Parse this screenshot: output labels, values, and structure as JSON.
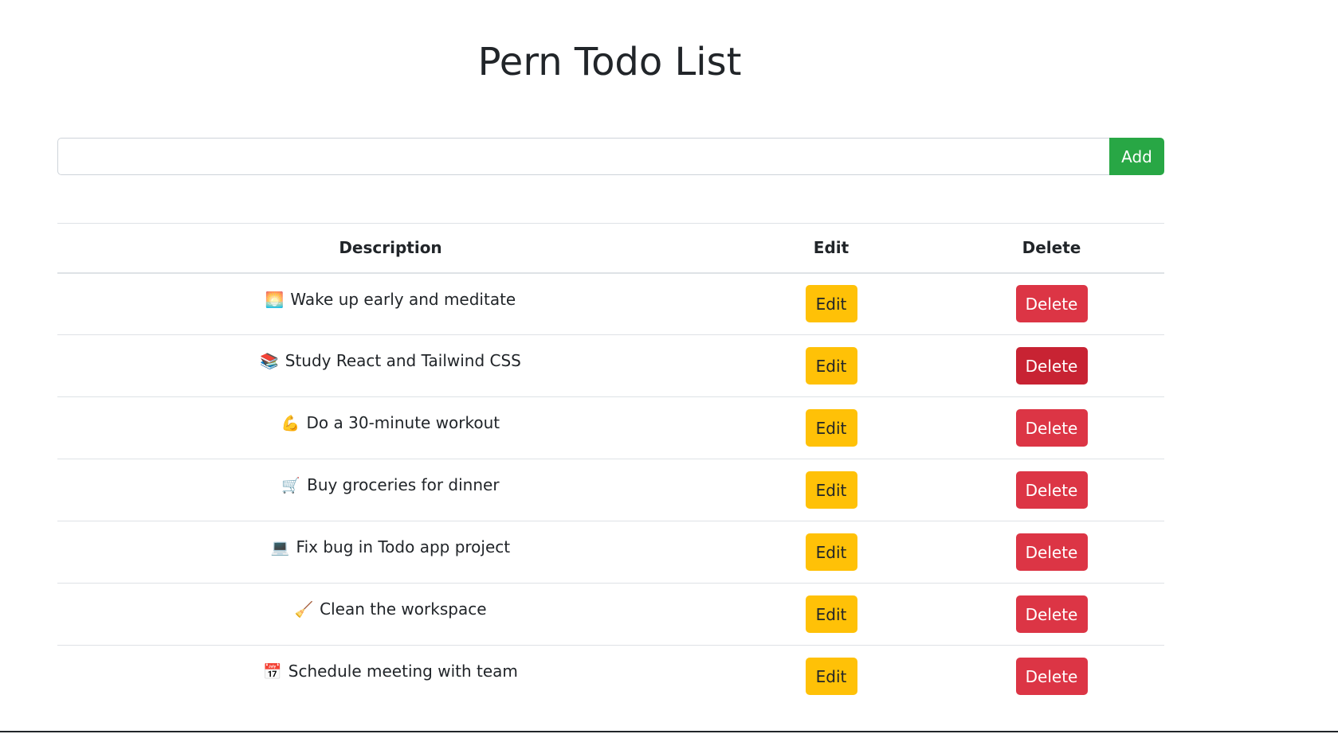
{
  "title": "Pern Todo List",
  "input": {
    "value": "",
    "placeholder": ""
  },
  "add_button_label": "Add",
  "table": {
    "headers": [
      "Description",
      "Edit",
      "Delete"
    ],
    "rows": [
      {
        "emoji": "🌅",
        "description": "Wake up early and meditate",
        "edit_label": "Edit",
        "delete_label": "Delete"
      },
      {
        "emoji": "📚",
        "description": "Study React and Tailwind CSS",
        "edit_label": "Edit",
        "delete_label": "Delete"
      },
      {
        "emoji": "💪",
        "description": "Do a 30-minute workout",
        "edit_label": "Edit",
        "delete_label": "Delete"
      },
      {
        "emoji": "🛒",
        "description": "Buy groceries for dinner",
        "edit_label": "Edit",
        "delete_label": "Delete"
      },
      {
        "emoji": "💻",
        "description": "Fix bug in Todo app project",
        "edit_label": "Edit",
        "delete_label": "Delete"
      },
      {
        "emoji": "🧹",
        "description": "Clean the workspace",
        "edit_label": "Edit",
        "delete_label": "Delete"
      },
      {
        "emoji": "📅",
        "description": "Schedule meeting with team",
        "edit_label": "Edit",
        "delete_label": "Delete"
      }
    ]
  },
  "colors": {
    "add_button": "#28a745",
    "edit_button": "#ffc107",
    "delete_button": "#dc3545",
    "delete_button_hover": "#c82333"
  }
}
